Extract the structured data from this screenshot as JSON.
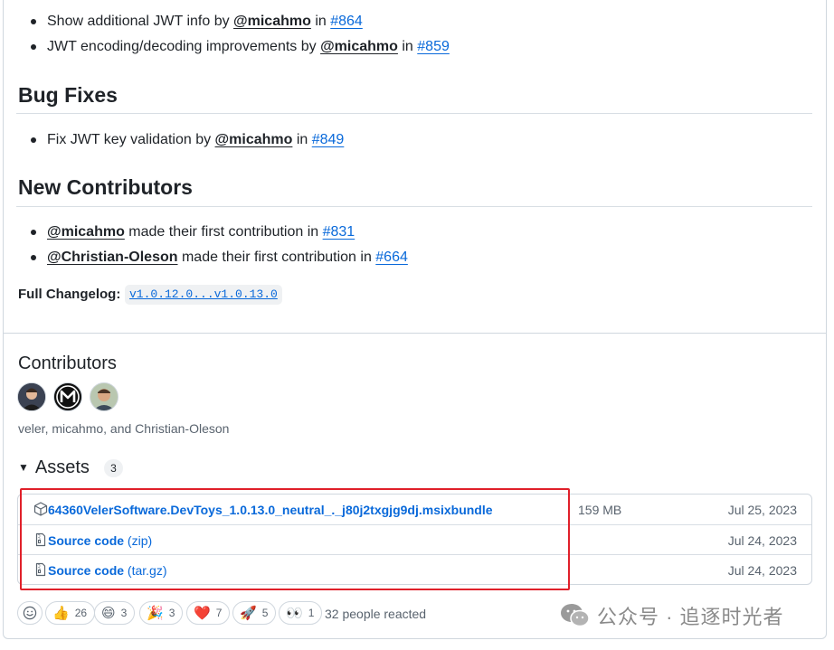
{
  "release_notes": {
    "partial_item_top": "",
    "items_top": [
      {
        "text": "Show additional JWT info by ",
        "author": "@micahmo",
        "in": " in ",
        "pr": "#864"
      },
      {
        "text": "JWT encoding/decoding improvements by ",
        "author": "@micahmo",
        "in": " in ",
        "pr": "#859"
      }
    ],
    "bug_fixes": {
      "heading": "Bug Fixes",
      "items": [
        {
          "text": "Fix JWT key validation by ",
          "author": "@micahmo",
          "in": " in ",
          "pr": "#849"
        }
      ]
    },
    "new_contributors": {
      "heading": "New Contributors",
      "items": [
        {
          "author": "@micahmo",
          "text": " made their first contribution in ",
          "pr": "#831"
        },
        {
          "author": "@Christian-Oleson",
          "text": " made their first contribution in ",
          "pr": "#664"
        }
      ]
    },
    "full_changelog_label": "Full Changelog:",
    "full_changelog_range": "v1.0.12.0...v1.0.13.0"
  },
  "contributors": {
    "title": "Contributors",
    "names": "veler, micahmo, and Christian-Oleson",
    "avatars": [
      "veler",
      "micahmo",
      "Christian-Oleson"
    ]
  },
  "assets": {
    "title": "Assets",
    "count": "3",
    "rows": [
      {
        "icon": "package-icon",
        "name": "64360VelerSoftware.DevToys_1.0.13.0_neutral_._j80j2txgjg9dj.msixbundle",
        "ext": "",
        "size": "159 MB",
        "date": "Jul 25, 2023"
      },
      {
        "icon": "file-zip-icon",
        "name": "Source code",
        "ext": " (zip)",
        "size": "",
        "date": "Jul 24, 2023"
      },
      {
        "icon": "file-zip-icon",
        "name": "Source code",
        "ext": " (tar.gz)",
        "size": "",
        "date": "Jul 24, 2023"
      }
    ],
    "highlight_color": "#e0202a"
  },
  "reactions": {
    "items": [
      {
        "emoji": "👍",
        "count": "26"
      },
      {
        "emoji": "😄",
        "count": "3"
      },
      {
        "emoji": "🎉",
        "count": "3"
      },
      {
        "emoji": "❤️",
        "count": "7"
      },
      {
        "emoji": "🚀",
        "count": "5"
      },
      {
        "emoji": "👀",
        "count": "1"
      }
    ],
    "summary": "32 people reacted"
  },
  "watermark": {
    "text": "公众号 · 追逐时光者"
  },
  "colors": {
    "link": "#0969da",
    "text": "#1f2328",
    "muted": "#59636e",
    "border": "#d0d7de"
  }
}
